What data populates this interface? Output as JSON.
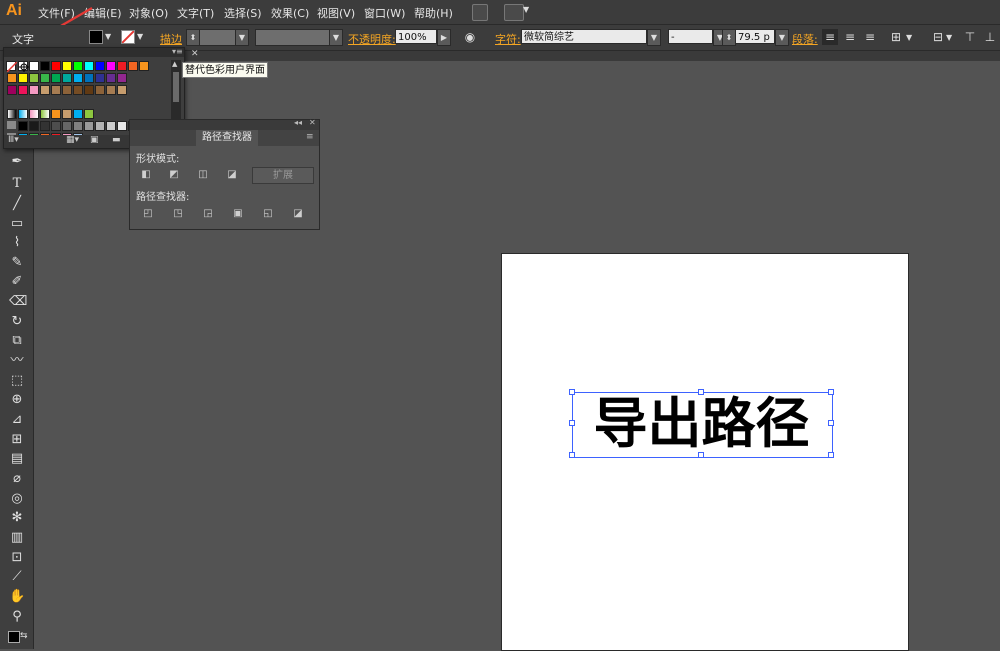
{
  "app": {
    "logo": "Ai"
  },
  "menubar": {
    "items": [
      "文件(F)",
      "编辑(E)",
      "对象(O)",
      "文字(T)",
      "选择(S)",
      "效果(C)",
      "视图(V)",
      "窗口(W)",
      "帮助(H)"
    ]
  },
  "control_bar": {
    "tool_label": "文字",
    "stroke_label": "描边",
    "opacity_label": "不透明度:",
    "opacity_value": "100%",
    "character_label": "字符:",
    "font_family": "微软简综艺",
    "font_style": "-",
    "font_size": "79.5 p",
    "paragraph_label": "段落:"
  },
  "swatches": {
    "colors": {
      "row1": [
        "#ffffff",
        "#000000",
        "#ff0000",
        "#ffff00",
        "#00ff00",
        "#00ffff",
        "#0000ff",
        "#ff00ff",
        "#ed1c24",
        "#f26522",
        "#f7941d"
      ],
      "row2": [
        "#f7941d",
        "#fff200",
        "#8dc63f",
        "#39b54a",
        "#00a651",
        "#00a99d",
        "#00aeef",
        "#0072bc",
        "#2e3192",
        "#662d91",
        "#92278f"
      ],
      "row3": [
        "#9e005d",
        "#ed145b",
        "#f49ac2",
        "#c69c6d",
        "#a67c52",
        "#8c6239",
        "#754c24",
        "#603913",
        "#8c6239",
        "#a67c52",
        "#c69c6d"
      ],
      "row5": [
        "#000000",
        "#1a1a1a",
        "#333333",
        "#4d4d4d",
        "#666666",
        "#808080",
        "#999999",
        "#b3b3b3",
        "#cccccc",
        "#e6e6e6",
        "#ffffff"
      ],
      "row6": [
        "#00aeef",
        "#39b54a",
        "#f26522",
        "#ed1c24",
        "#f49ac2",
        "#a0c4e8"
      ]
    }
  },
  "tooltip": {
    "text": "替代色彩用户界面"
  },
  "pathfinder": {
    "tab_label": "路径查找器",
    "shape_modes_label": "形状模式:",
    "expand_label": "扩展",
    "pathfinders_label": "路径查找器:"
  },
  "artboard": {
    "text": "导出路径"
  },
  "accent": {
    "selection_blue": "#3d62ff",
    "arrow_red": "#e53935",
    "logo_orange": "#f7941d"
  }
}
